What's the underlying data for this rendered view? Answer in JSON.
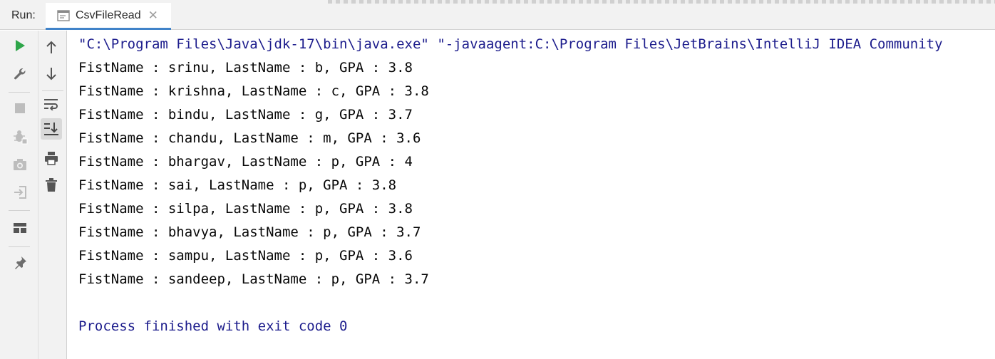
{
  "run_panel": {
    "label": "Run:",
    "tab": {
      "title": "CsvFileRead",
      "close_symbol": "✕"
    }
  },
  "icons": {
    "left_toolbar": [
      "run-icon",
      "wrench-icon",
      "stop-icon",
      "debug-icon",
      "camera-icon",
      "login-icon",
      "layout-icon",
      "pin-icon"
    ],
    "right_toolbar": [
      "arrow-up-icon",
      "arrow-down-icon",
      "soft-wrap-icon",
      "scroll-to-end-icon",
      "print-icon",
      "trash-icon"
    ]
  },
  "colors": {
    "run_green": "#2ea64a",
    "icon_gray": "#6e6e6e",
    "command_blue": "#1c1c8c",
    "tab_underline": "#4083c9"
  },
  "console": {
    "command": "\"C:\\Program Files\\Java\\jdk-17\\bin\\java.exe\" \"-javaagent:C:\\Program Files\\JetBrains\\IntelliJ IDEA Community",
    "output": [
      "FistName : srinu, LastName : b, GPA : 3.8",
      "FistName : krishna, LastName : c, GPA : 3.8",
      "FistName : bindu, LastName : g, GPA : 3.7",
      "FistName : chandu, LastName : m, GPA : 3.6",
      "FistName : bhargav, LastName : p, GPA : 4",
      "FistName : sai, LastName : p, GPA : 3.8",
      "FistName : silpa, LastName : p, GPA : 3.8",
      "FistName : bhavya, LastName : p, GPA : 3.7",
      "FistName : sampu, LastName : p, GPA : 3.6",
      "FistName : sandeep, LastName : p, GPA : 3.7"
    ],
    "exit_message": "Process finished with exit code 0"
  }
}
